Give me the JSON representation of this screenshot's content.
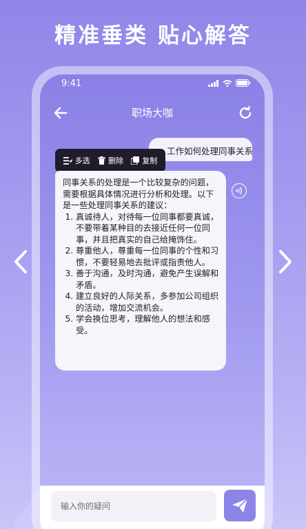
{
  "headline": "精准垂类 贴心解答",
  "status_bar": {
    "time": "9:41"
  },
  "header": {
    "title": "职场大咖"
  },
  "chat": {
    "user_message": "工作如何处理同事关系",
    "context_menu": {
      "multi_select": "多选",
      "delete": "删除",
      "copy": "复制"
    },
    "bot_message": {
      "intro": "同事关系的处理是一个比较复杂的问题，需要根据具体情况进行分析和处理。以下是一些处理同事关系的建议：",
      "points": [
        "真诚待人，对待每一位同事都要真诚，不要带着某种目的去接近任何一位同事，并且把真实的自己给掩饰住。",
        "尊重他人，尊重每一位同事的个性和习惯，不要轻易地去批评或指责他人。",
        "善于沟通，及时沟通，避免产生误解和矛盾。",
        "建立良好的人际关系，多参加公司组织的活动，增加交流机会。",
        "学会换位思考，理解他人的想法和感受。"
      ]
    }
  },
  "input": {
    "placeholder": "输入你的疑问"
  },
  "icons": {
    "back": "arrow-left-icon",
    "refresh": "refresh-icon",
    "speaker": "speaker-icon",
    "send": "send-icon",
    "prev": "chevron-left-icon",
    "next": "chevron-right-icon"
  },
  "colors": {
    "accent": "#8d84e8",
    "menu_bg": "#1f1d2b",
    "bubble_bg": "#f6f5fc"
  }
}
